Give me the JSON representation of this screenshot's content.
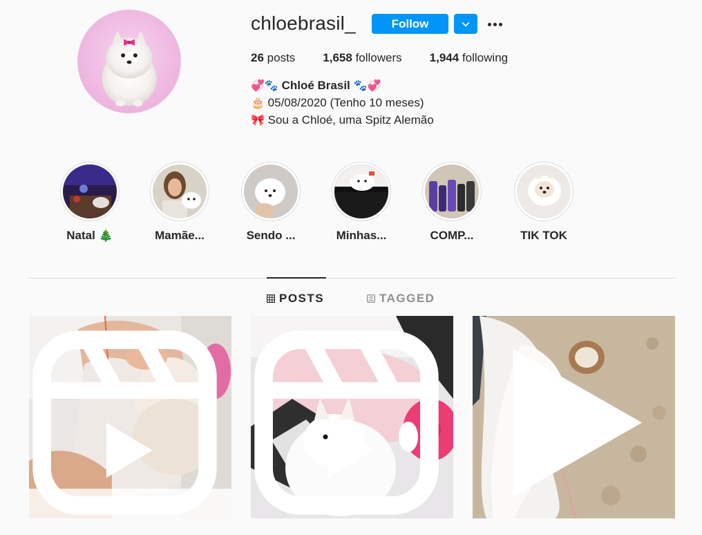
{
  "profile": {
    "username": "chloebrasil_",
    "follow_label": "Follow",
    "posts_count": "26",
    "posts_label": "posts",
    "followers_count": "1,658",
    "followers_label": "followers",
    "following_count": "1,944",
    "following_label": "following"
  },
  "bio": {
    "line1_prefix": "💞🐾",
    "name": "Chloé Brasil",
    "line1_suffix": "🐾💞",
    "line2_emoji": "🎂",
    "line2_text": "05/08/2020 (Tenho 10 meses)",
    "line3_emoji": "🎀",
    "line3_text": "Sou a Chloé, uma Spitz Alemão"
  },
  "highlights": [
    {
      "label": "Natal 🎄"
    },
    {
      "label": "Mamãe..."
    },
    {
      "label": "Sendo ..."
    },
    {
      "label": "Minhas..."
    },
    {
      "label": "COMP..."
    },
    {
      "label": "TIK TOK"
    }
  ],
  "tabs": {
    "posts": "POSTS",
    "tagged": "TAGGED"
  },
  "posts": [
    {
      "type": "reel-icon"
    },
    {
      "type": "reel-icon"
    },
    {
      "type": "video-play-icon"
    }
  ],
  "colors": {
    "accent": "#0095f6",
    "text": "#262626",
    "muted": "#8e8e8e",
    "background": "#fafafa"
  }
}
